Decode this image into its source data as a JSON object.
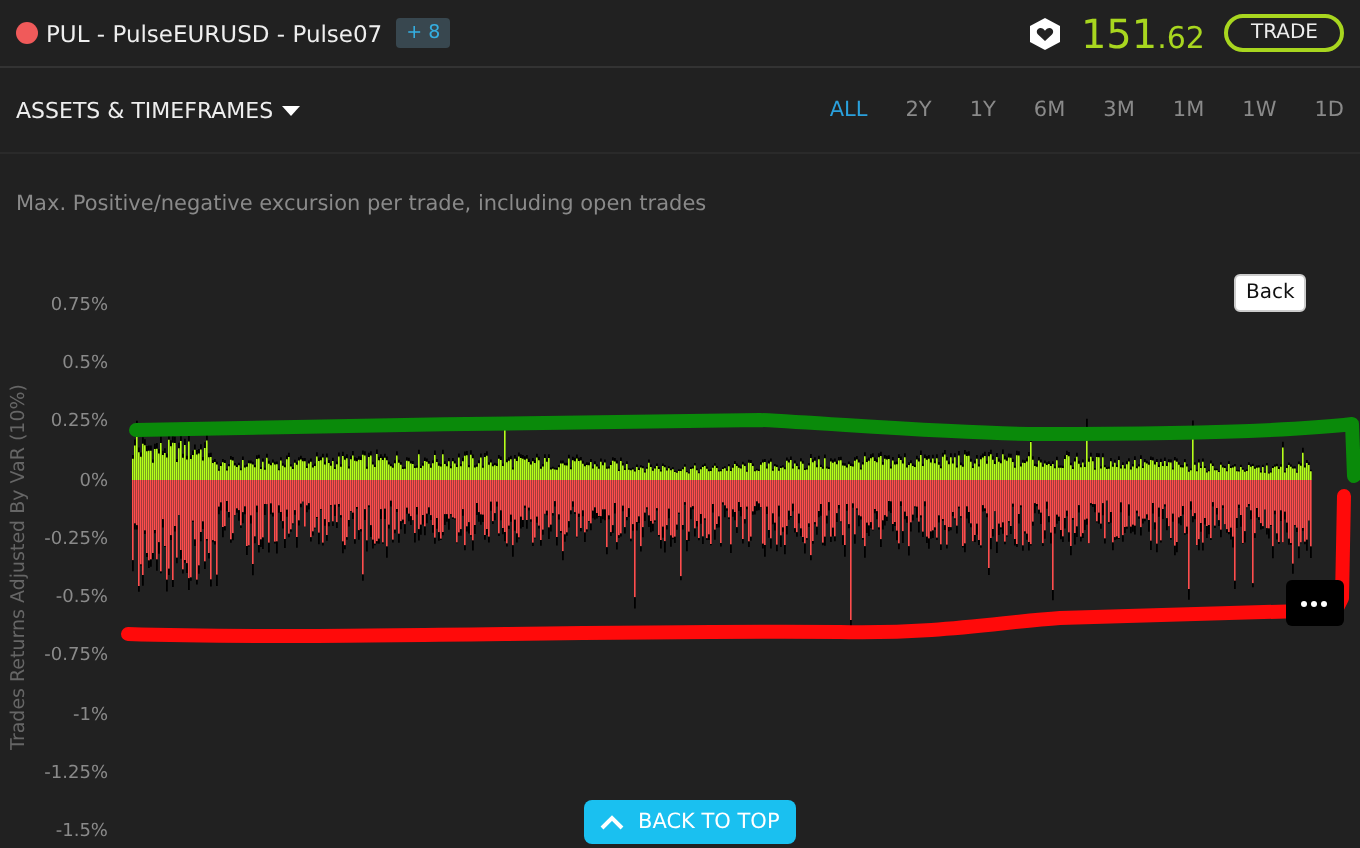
{
  "header": {
    "title": "PUL - PulseEURUSD - Pulse07",
    "badge": "+ 8",
    "price_whole": "151",
    "price_fraction": ".62",
    "trade_button": "TRADE"
  },
  "filters": {
    "menu_label": "ASSETS & TIMEFRAMES",
    "ranges": [
      {
        "label": "ALL",
        "selected": true
      },
      {
        "label": "2Y",
        "selected": false
      },
      {
        "label": "1Y",
        "selected": false
      },
      {
        "label": "6M",
        "selected": false
      },
      {
        "label": "3M",
        "selected": false
      },
      {
        "label": "1M",
        "selected": false
      },
      {
        "label": "1W",
        "selected": false
      },
      {
        "label": "1D",
        "selected": false
      }
    ]
  },
  "chart": {
    "subtitle": "Max. Positive/negative excursion per trade, including open trades",
    "y_axis_title": "Trades Returns Adjusted By VaR (10%)",
    "y_ticks": [
      "0.75%",
      "0.5%",
      "0.25%",
      "0%",
      "-0.25%",
      "-0.5%",
      "-0.75%",
      "-1%",
      "-1.25%",
      "-1.5%"
    ],
    "back_button": "Back",
    "back_to_top": "BACK TO TOP"
  }
}
